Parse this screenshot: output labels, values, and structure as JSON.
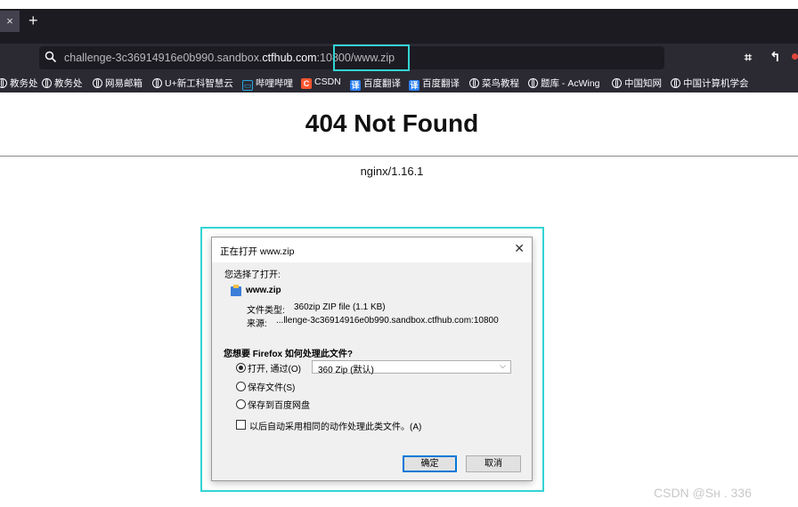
{
  "browser": {
    "tab_close": "×",
    "new_tab": "+",
    "url": {
      "prefix": "challenge-3c36914916e0b990.sandbox.",
      "host": "ctfhub.com",
      "suffix": ":10800/www.zip"
    },
    "bookmarks": [
      {
        "label": "教务处",
        "icon": "globe-icon"
      },
      {
        "label": "教务处",
        "icon": "globe-icon"
      },
      {
        "label": "网易邮箱",
        "icon": "globe-icon"
      },
      {
        "label": "U+新工科智慧云",
        "icon": "globe-icon"
      },
      {
        "label": "哔哩哔哩",
        "icon": "bilibili-icon"
      },
      {
        "label": "CSDN",
        "icon": "csdn-icon"
      },
      {
        "label": "百度翻译",
        "icon": "translate-icon"
      },
      {
        "label": "百度翻译",
        "icon": "translate-icon"
      },
      {
        "label": "菜鸟教程",
        "icon": "globe-icon"
      },
      {
        "label": "题库 - AcWing",
        "icon": "globe-icon"
      },
      {
        "label": "中国知网",
        "icon": "globe-icon"
      },
      {
        "label": "中国计算机学会",
        "icon": "globe-icon"
      }
    ]
  },
  "page": {
    "title": "404 Not Found",
    "server": "nginx/1.16.1"
  },
  "dialog": {
    "title": "正在打开 www.zip",
    "chosen_label": "您选择了打开:",
    "filename": "www.zip",
    "type_label": "文件类型:",
    "type_value": "360zip ZIP file (1.1 KB)",
    "source_label": "来源:",
    "source_value": "...llenge-3c36914916e0b990.sandbox.ctfhub.com:10800",
    "question": "您想要 Firefox 如何处理此文件?",
    "open_with_label": "打开, 通过(O)",
    "open_with_value": "360 Zip (默认)",
    "save_label": "保存文件(S)",
    "save_baidu_label": "保存到百度网盘",
    "auto_label": "以后自动采用相同的动作处理此类文件。(A)",
    "ok": "确定",
    "cancel": "取消"
  },
  "watermark": "CSDN @Sн      . 336"
}
